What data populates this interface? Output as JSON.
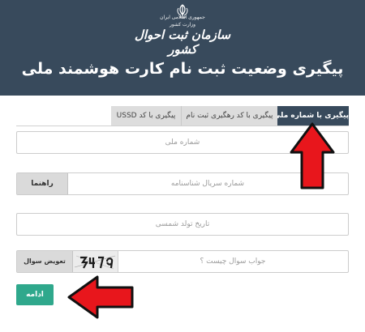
{
  "header": {
    "org_line_1": "جمهوری اسلامی ایران",
    "org_line_2": "وزارت کشور",
    "org_name": "سازمان ثبت احوال کشور",
    "title": "پیگیری وضعیت ثبت نام کارت هوشمند ملی"
  },
  "tabs": [
    {
      "label": "پیگیری با شماره ملی",
      "active": true
    },
    {
      "label": "پیگیری با کد رهگیری ثبت نام",
      "active": false
    },
    {
      "label": "پیگیری با کد USSD",
      "active": false
    }
  ],
  "form": {
    "national_code": {
      "placeholder": "شماره ملی",
      "value": ""
    },
    "serial": {
      "placeholder": "شماره سریال شناسنامه",
      "value": "",
      "help_button": "راهنما"
    },
    "birth_date": {
      "placeholder": "تاریخ تولد شمسی",
      "value": ""
    },
    "captcha": {
      "placeholder": "جواب سوال چیست ؟",
      "value": "",
      "refresh_button": "تعویض سوال"
    },
    "submit_label": "ادامه"
  },
  "colors": {
    "header_bg": "#384a5c",
    "active_tab": "#384a5c",
    "submit_bg": "#2fa88c",
    "annotation_arrow": "#e8161c"
  }
}
